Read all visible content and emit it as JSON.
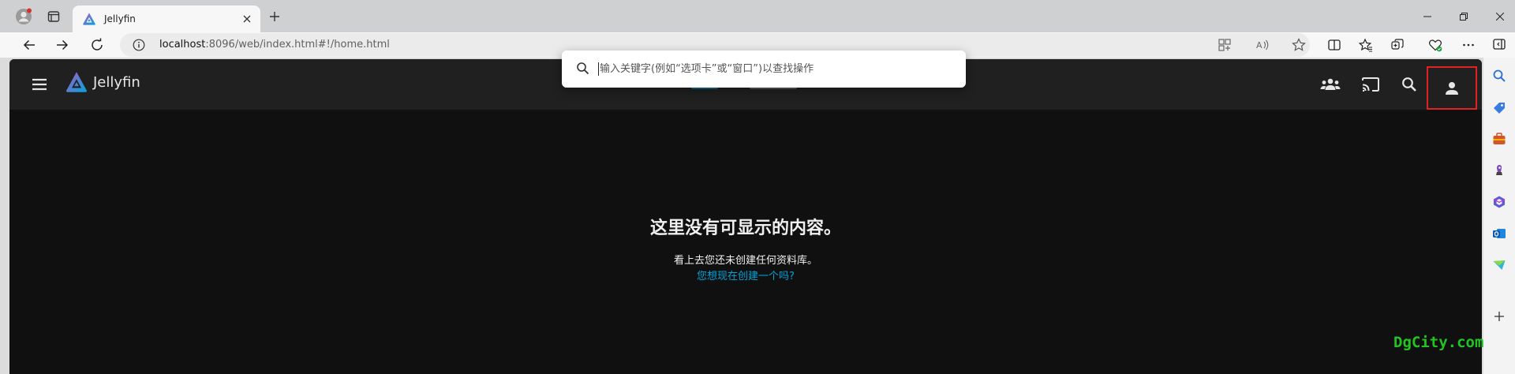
{
  "colors": {
    "accent": "#00a4dc",
    "highlight_box": "#e02222",
    "watermark": "#22c422",
    "app_background": "#101010",
    "header_background": "#202020"
  },
  "browser": {
    "tab": {
      "title": "Jellyfin",
      "close_icon": "close-icon",
      "favicon": "jellyfin-logo-icon"
    },
    "window_controls": [
      "minimize-icon",
      "restore-icon",
      "close-icon"
    ],
    "address_bar": {
      "url_host": "localhost",
      "url_rest": ":8096/web/index.html#!/home.html"
    },
    "toolbar_icons": [
      "app-available-icon",
      "read-aloud-icon",
      "favorite-star-icon",
      "split-screen-icon",
      "favorites-icon",
      "collections-icon",
      "browser-essentials-icon",
      "more-icon"
    ],
    "sidebar_icons": [
      "search-icon",
      "shopping-tag-icon",
      "tools-icon",
      "games-icon",
      "microsoft365-icon",
      "outlook-icon",
      "drop-icon",
      "add-icon"
    ]
  },
  "jellyfin": {
    "brand": "Jellyfin",
    "header_icons": [
      "menu-icon",
      "users-icon",
      "cast-icon",
      "search-icon",
      "user-icon"
    ],
    "empty_state": {
      "title": "这里没有可显示的内容。",
      "description": "看上去您还未创建任何资料库。",
      "link": "您想现在创建一个吗?"
    }
  },
  "command_palette": {
    "placeholder": "输入关键字(例如“选项卡”或“窗口”)以查找操作",
    "value": ""
  },
  "watermark": "DgCity.com"
}
